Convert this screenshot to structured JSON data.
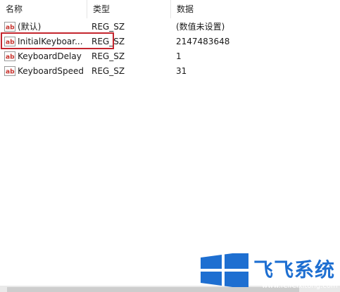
{
  "columns": {
    "name": "名称",
    "type": "类型",
    "data": "数据"
  },
  "rows": [
    {
      "name": "(默认)",
      "type": "REG_SZ",
      "data": "(数值未设置)"
    },
    {
      "name": "InitialKeyboar...",
      "type": "REG_SZ",
      "data": "2147483648"
    },
    {
      "name": "KeyboardDelay",
      "type": "REG_SZ",
      "data": "1"
    },
    {
      "name": "KeyboardSpeed",
      "type": "REG_SZ",
      "data": "31"
    }
  ],
  "watermark": {
    "text": "飞飞系统",
    "url": "www.feifeixitong.com",
    "color": "#1e6fd1"
  },
  "icon": {
    "name": "reg-string-icon",
    "label": "ab"
  },
  "colors": {
    "highlight": "#c4262e",
    "icon_red": "#c8312b"
  }
}
